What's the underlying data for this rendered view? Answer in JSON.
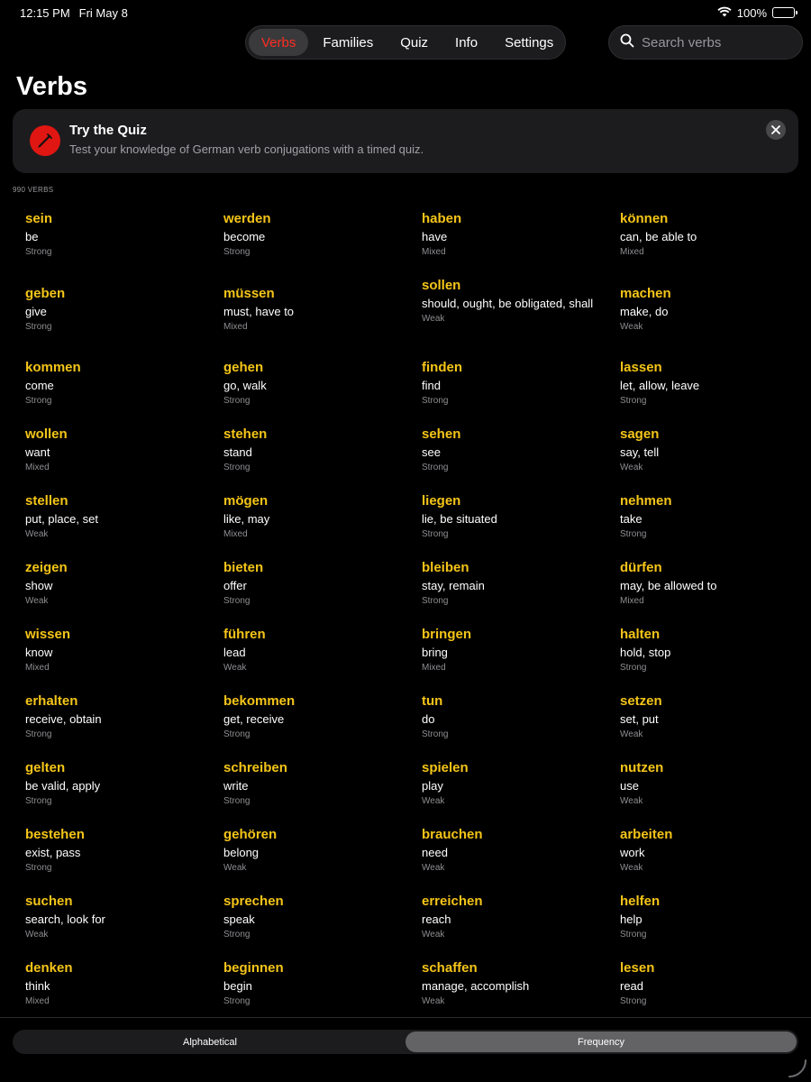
{
  "status": {
    "time": "12:15 PM",
    "date": "Fri May 8",
    "battery": "100%"
  },
  "tabs": [
    {
      "label": "Verbs",
      "active": true
    },
    {
      "label": "Families",
      "active": false
    },
    {
      "label": "Quiz",
      "active": false
    },
    {
      "label": "Info",
      "active": false
    },
    {
      "label": "Settings",
      "active": false
    }
  ],
  "search": {
    "placeholder": "Search verbs",
    "value": ""
  },
  "page_title": "Verbs",
  "banner": {
    "title": "Try the Quiz",
    "subtitle": "Test your knowledge of German verb conjugations with a timed quiz."
  },
  "count_label": "990 VERBS",
  "verbs": [
    {
      "name": "sein",
      "translation": "be",
      "type": "Strong"
    },
    {
      "name": "werden",
      "translation": "become",
      "type": "Strong"
    },
    {
      "name": "haben",
      "translation": "have",
      "type": "Mixed"
    },
    {
      "name": "können",
      "translation": "can, be able to",
      "type": "Mixed"
    },
    {
      "name": "geben",
      "translation": "give",
      "type": "Strong"
    },
    {
      "name": "müssen",
      "translation": "must, have to",
      "type": "Mixed"
    },
    {
      "name": "sollen",
      "translation": "should, ought, be obligated, shall",
      "type": "Weak"
    },
    {
      "name": "machen",
      "translation": "make, do",
      "type": "Weak"
    },
    {
      "name": "kommen",
      "translation": "come",
      "type": "Strong"
    },
    {
      "name": "gehen",
      "translation": "go, walk",
      "type": "Strong"
    },
    {
      "name": "finden",
      "translation": "find",
      "type": "Strong"
    },
    {
      "name": "lassen",
      "translation": "let, allow, leave",
      "type": "Strong"
    },
    {
      "name": "wollen",
      "translation": "want",
      "type": "Mixed"
    },
    {
      "name": "stehen",
      "translation": "stand",
      "type": "Strong"
    },
    {
      "name": "sehen",
      "translation": "see",
      "type": "Strong"
    },
    {
      "name": "sagen",
      "translation": "say, tell",
      "type": "Weak"
    },
    {
      "name": "stellen",
      "translation": "put, place, set",
      "type": "Weak"
    },
    {
      "name": "mögen",
      "translation": "like, may",
      "type": "Mixed"
    },
    {
      "name": "liegen",
      "translation": "lie, be situated",
      "type": "Strong"
    },
    {
      "name": "nehmen",
      "translation": "take",
      "type": "Strong"
    },
    {
      "name": "zeigen",
      "translation": "show",
      "type": "Weak"
    },
    {
      "name": "bieten",
      "translation": "offer",
      "type": "Strong"
    },
    {
      "name": "bleiben",
      "translation": "stay, remain",
      "type": "Strong"
    },
    {
      "name": "dürfen",
      "translation": "may, be allowed to",
      "type": "Mixed"
    },
    {
      "name": "wissen",
      "translation": "know",
      "type": "Mixed"
    },
    {
      "name": "führen",
      "translation": "lead",
      "type": "Weak"
    },
    {
      "name": "bringen",
      "translation": "bring",
      "type": "Mixed"
    },
    {
      "name": "halten",
      "translation": "hold, stop",
      "type": "Strong"
    },
    {
      "name": "erhalten",
      "translation": "receive, obtain",
      "type": "Strong"
    },
    {
      "name": "bekommen",
      "translation": "get, receive",
      "type": "Strong"
    },
    {
      "name": "tun",
      "translation": "do",
      "type": "Strong"
    },
    {
      "name": "setzen",
      "translation": "set, put",
      "type": "Weak"
    },
    {
      "name": "gelten",
      "translation": "be valid, apply",
      "type": "Strong"
    },
    {
      "name": "schreiben",
      "translation": "write",
      "type": "Strong"
    },
    {
      "name": "spielen",
      "translation": "play",
      "type": "Weak"
    },
    {
      "name": "nutzen",
      "translation": "use",
      "type": "Weak"
    },
    {
      "name": "bestehen",
      "translation": "exist, pass",
      "type": "Strong"
    },
    {
      "name": "gehören",
      "translation": "belong",
      "type": "Weak"
    },
    {
      "name": "brauchen",
      "translation": "need",
      "type": "Weak"
    },
    {
      "name": "arbeiten",
      "translation": "work",
      "type": "Weak"
    },
    {
      "name": "suchen",
      "translation": "search, look for",
      "type": "Weak"
    },
    {
      "name": "sprechen",
      "translation": "speak",
      "type": "Strong"
    },
    {
      "name": "erreichen",
      "translation": "reach",
      "type": "Weak"
    },
    {
      "name": "helfen",
      "translation": "help",
      "type": "Strong"
    },
    {
      "name": "denken",
      "translation": "think",
      "type": "Mixed"
    },
    {
      "name": "beginnen",
      "translation": "begin",
      "type": "Strong"
    },
    {
      "name": "schaffen",
      "translation": "manage, accomplish",
      "type": "Weak"
    },
    {
      "name": "lesen",
      "translation": "read",
      "type": "Strong"
    }
  ],
  "sort": [
    {
      "label": "Alphabetical",
      "active": false
    },
    {
      "label": "Frequency",
      "active": true
    }
  ],
  "colors": {
    "accent": "#f5c518",
    "active_tab": "#ff2d20",
    "banner_icon": "#e01612"
  },
  "icons": {
    "banner": "syringe-icon",
    "search": "search-icon",
    "close": "close-icon",
    "wifi": "wifi-icon",
    "battery": "battery-icon"
  }
}
